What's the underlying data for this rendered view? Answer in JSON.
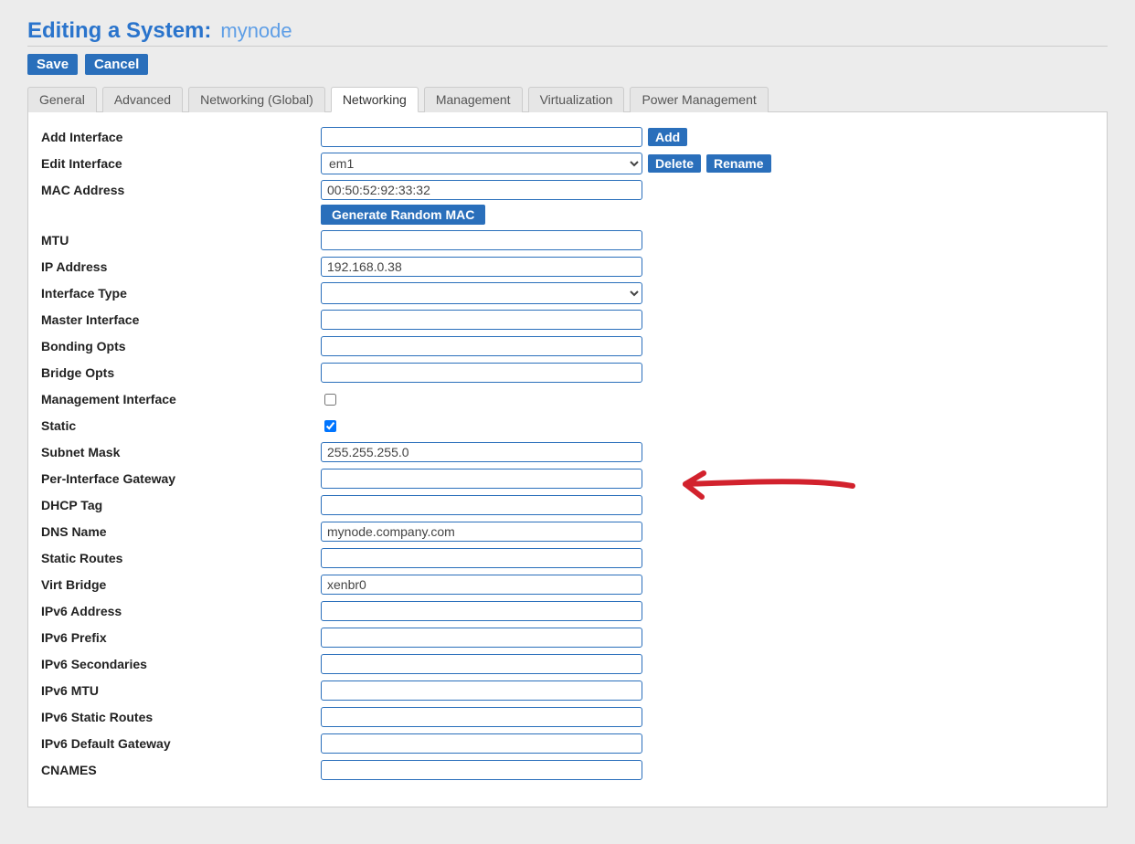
{
  "header": {
    "title_prefix": "Editing a System:",
    "title_name": "mynode"
  },
  "buttons": {
    "save": "Save",
    "cancel": "Cancel",
    "add": "Add",
    "delete": "Delete",
    "rename": "Rename",
    "gen_mac": "Generate Random MAC"
  },
  "tabs": {
    "general": "General",
    "advanced": "Advanced",
    "networking_global": "Networking (Global)",
    "networking": "Networking",
    "management": "Management",
    "virtualization": "Virtualization",
    "power_management": "Power Management"
  },
  "labels": {
    "add_interface": "Add Interface",
    "edit_interface": "Edit Interface",
    "mac_address": "MAC Address",
    "mtu": "MTU",
    "ip_address": "IP Address",
    "interface_type": "Interface Type",
    "master_interface": "Master Interface",
    "bonding_opts": "Bonding Opts",
    "bridge_opts": "Bridge Opts",
    "management_interface": "Management Interface",
    "static": "Static",
    "subnet_mask": "Subnet Mask",
    "per_interface_gateway": "Per-Interface Gateway",
    "dhcp_tag": "DHCP Tag",
    "dns_name": "DNS Name",
    "static_routes": "Static Routes",
    "virt_bridge": "Virt Bridge",
    "ipv6_address": "IPv6 Address",
    "ipv6_prefix": "IPv6 Prefix",
    "ipv6_secondaries": "IPv6 Secondaries",
    "ipv6_mtu": "IPv6 MTU",
    "ipv6_static_routes": "IPv6 Static Routes",
    "ipv6_default_gateway": "IPv6 Default Gateway",
    "cnames": "CNAMES"
  },
  "values": {
    "add_interface": "",
    "edit_interface": "em1",
    "mac_address": "00:50:52:92:33:32",
    "mtu": "",
    "ip_address": "192.168.0.38",
    "interface_type": "",
    "master_interface": "",
    "bonding_opts": "",
    "bridge_opts": "",
    "management_interface": false,
    "static": true,
    "subnet_mask": "255.255.255.0",
    "per_interface_gateway": "",
    "dhcp_tag": "",
    "dns_name": "mynode.company.com",
    "static_routes": "",
    "virt_bridge": "xenbr0",
    "ipv6_address": "",
    "ipv6_prefix": "",
    "ipv6_secondaries": "",
    "ipv6_mtu": "",
    "ipv6_static_routes": "",
    "ipv6_default_gateway": "",
    "cnames": ""
  },
  "annotation": {
    "target_field": "dns_name",
    "color": "#d2222d"
  }
}
